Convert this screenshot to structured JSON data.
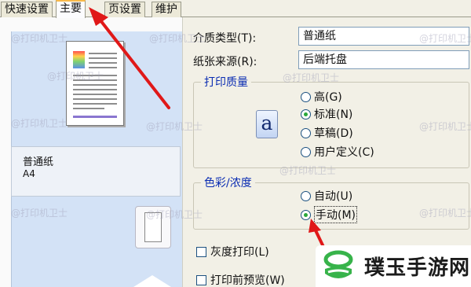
{
  "tabs": [
    {
      "label": "快速设置",
      "active": false
    },
    {
      "label": "主要",
      "active": true
    },
    {
      "label": "页设置",
      "active": false
    },
    {
      "label": "维护",
      "active": false
    }
  ],
  "preview": {
    "media_name": "普通纸",
    "paper_size": "A4"
  },
  "settings": {
    "media_type_label": "介质类型(T):",
    "media_type_value": "普通纸",
    "paper_source_label": "纸张来源(R):",
    "paper_source_value": "后端托盘"
  },
  "print_quality": {
    "title": "打印质量",
    "icon_glyph": "a",
    "options": [
      {
        "label": "高(G)",
        "selected": false
      },
      {
        "label": "标准(N)",
        "selected": true
      },
      {
        "label": "草稿(D)",
        "selected": false
      },
      {
        "label": "用户定义(C)",
        "selected": false
      }
    ]
  },
  "color_intensity": {
    "title": "色彩/浓度",
    "options": [
      {
        "label": "自动(U)",
        "selected": false
      },
      {
        "label": "手动(M)",
        "selected": true
      }
    ]
  },
  "checkboxes": {
    "grayscale_label": "灰度打印(L)",
    "grayscale_checked": false,
    "preview_label": "打印前预览(W)",
    "preview_checked": false
  },
  "watermark_text": "@打印机卫士",
  "brand": {
    "name": "璞玉手游网"
  },
  "colors": {
    "arrow": "#e01818",
    "group_title": "#0a2cb2",
    "active_tab_accent": "#f8b94a",
    "radio_dot": "#2aa83a",
    "logo_green": "#37b34a"
  }
}
